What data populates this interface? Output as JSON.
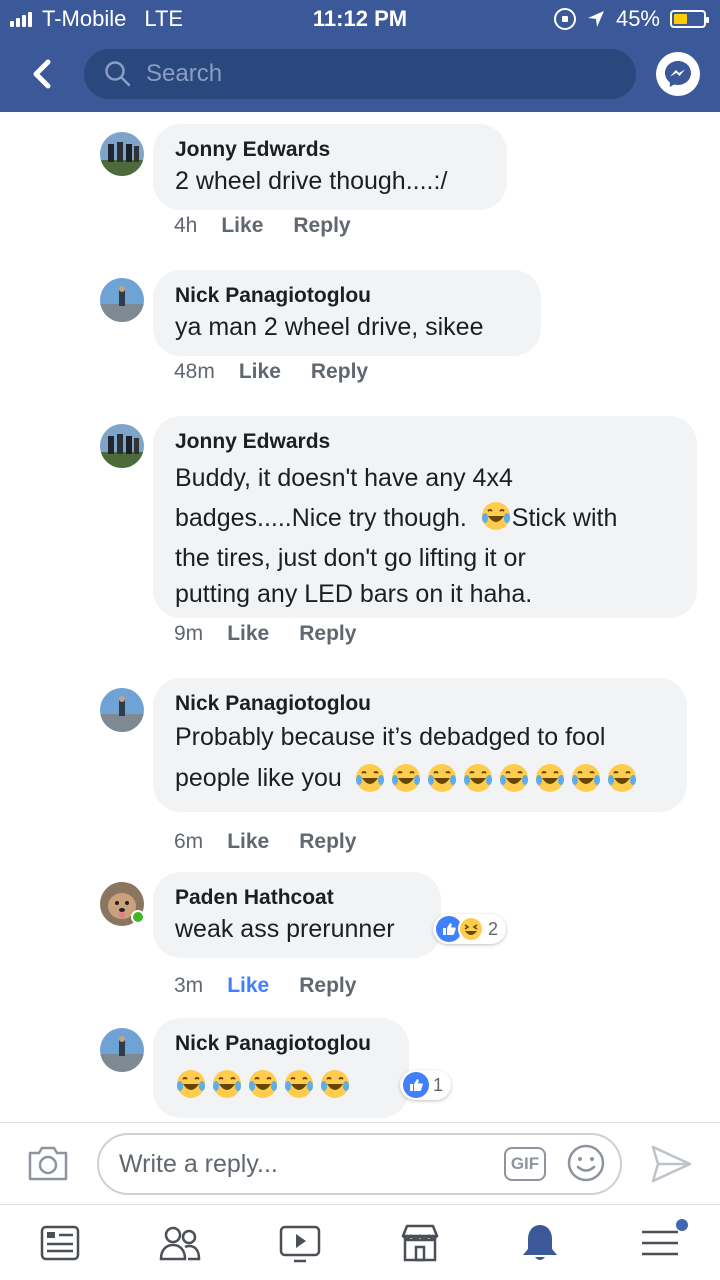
{
  "status_bar": {
    "carrier": "T-Mobile",
    "network": "LTE",
    "time": "11:12 PM",
    "battery": "45%",
    "battery_level": 0.45
  },
  "nav": {
    "search_placeholder": "Search",
    "icons": [
      "back-chevron-icon",
      "search-icon",
      "messenger-icon"
    ]
  },
  "colors": {
    "brand": "#3b5998",
    "bubble": "#f2f3f5",
    "like_active": "#4080ff",
    "meta_text": "#606770"
  },
  "comments": [
    {
      "author": "Jonny Edwards",
      "text": "2 wheel drive though....:/",
      "time": "4h",
      "like": "Like",
      "reply": "Reply"
    },
    {
      "author": "Nick Panagiotoglou",
      "text": "ya man 2 wheel drive, sikee",
      "time": "48m",
      "like": "Like",
      "reply": "Reply"
    },
    {
      "author": "Jonny Edwards",
      "text_line1": "Buddy, it doesn't have any 4x4",
      "text_line2a": "badges.....Nice try though.",
      "text_line2b": "Stick with",
      "text_line3": "the tires, just don't go lifting it or",
      "text_line4": "putting any LED bars on it haha.",
      "time": "9m",
      "like": "Like",
      "reply": "Reply"
    },
    {
      "author": "Nick Panagiotoglou",
      "text_line1": "Probably because it’s debadged to fool",
      "text_line2": "people like you",
      "emoji_count": 8,
      "time": "6m",
      "like": "Like",
      "reply": "Reply"
    },
    {
      "author": "Paden Hathcoat",
      "text": "weak ass prerunner",
      "time": "3m",
      "like": "Like",
      "reply": "Reply",
      "liked_by_me": true,
      "reactions": [
        "like-reaction-icon",
        "haha-reaction-icon"
      ],
      "reaction_count": "2",
      "online": true
    },
    {
      "author": "Nick Panagiotoglou",
      "emoji_count": 5,
      "reactions": [
        "like-reaction-icon"
      ],
      "reaction_count": "1"
    }
  ],
  "composer": {
    "placeholder": "Write a reply...",
    "gif_label": "GIF",
    "icons": [
      "camera-icon",
      "gif-icon",
      "smiley-icon",
      "send-icon"
    ]
  },
  "tabbar": {
    "items": [
      "news-feed-icon",
      "friends-icon",
      "watch-icon",
      "marketplace-icon",
      "notifications-icon",
      "menu-icon"
    ],
    "active": "notifications-icon"
  }
}
